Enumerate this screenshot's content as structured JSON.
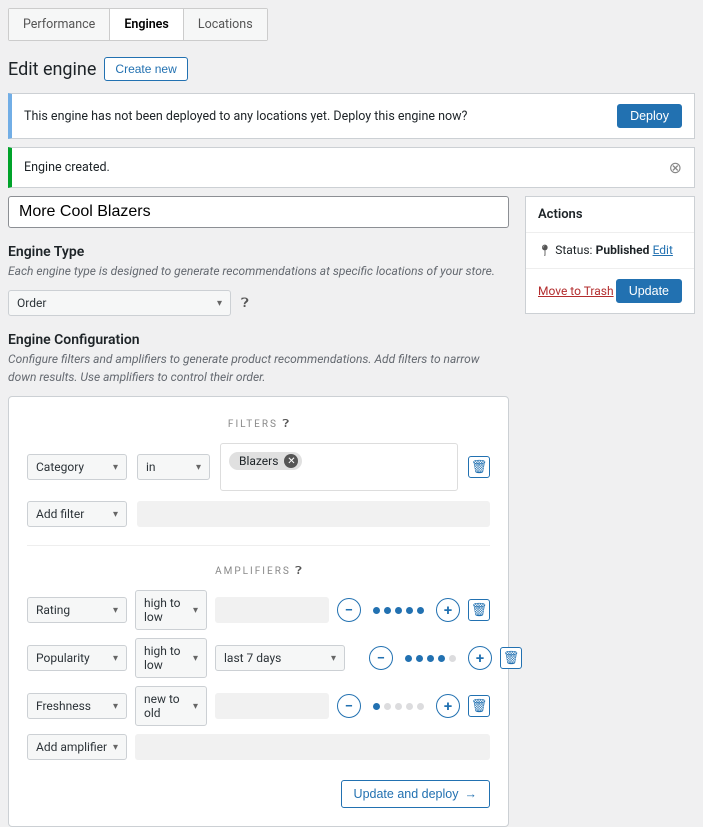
{
  "tabs": [
    "Performance",
    "Engines",
    "Locations"
  ],
  "page": {
    "title": "Edit engine",
    "create_new": "Create new"
  },
  "notices": {
    "deploy_msg": "This engine has not been deployed to any locations yet. Deploy this engine now?",
    "deploy_btn": "Deploy",
    "created_msg": "Engine created."
  },
  "engine_name": "More Cool Blazers",
  "type_section": {
    "heading": "Engine Type",
    "desc": "Each engine type is designed to generate recommendations at specific locations of your store.",
    "value": "Order"
  },
  "config_section": {
    "heading": "Engine Configuration",
    "desc": "Configure filters and amplifiers to generate product recommendations. Add filters to narrow down results. Use amplifiers to control their order.",
    "filters_label": "FILTERS",
    "amplifiers_label": "AMPLIFIERS",
    "filter": {
      "attr": "Category",
      "op": "in",
      "token": "Blazers"
    },
    "add_filter": "Add filter",
    "amps": [
      {
        "attr": "Rating",
        "dir": "high to low",
        "range": "",
        "weight": 5
      },
      {
        "attr": "Popularity",
        "dir": "high to low",
        "range": "last 7 days",
        "weight": 4
      },
      {
        "attr": "Freshness",
        "dir": "new to old",
        "range": "",
        "weight": 1
      }
    ],
    "add_amplifier": "Add amplifier",
    "update_deploy": "Update and deploy"
  },
  "sidebar": {
    "actions": "Actions",
    "status_label": "Status:",
    "status_value": "Published",
    "edit": "Edit",
    "trash": "Move to Trash",
    "update": "Update"
  }
}
